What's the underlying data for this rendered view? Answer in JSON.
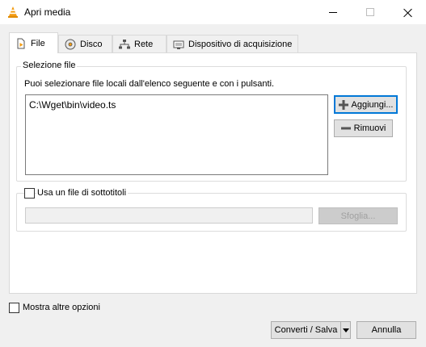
{
  "window": {
    "title": "Apri media",
    "minimize_icon": "minimize-icon",
    "maximize_icon": "maximize-icon",
    "close_icon": "close-icon"
  },
  "tabs": [
    {
      "label": "File",
      "icon": "file-icon",
      "active": true
    },
    {
      "label": "Disco",
      "icon": "disc-icon",
      "active": false
    },
    {
      "label": "Rete",
      "icon": "network-icon",
      "active": false
    },
    {
      "label": "Dispositivo di acquisizione",
      "icon": "capture-device-icon",
      "active": false
    }
  ],
  "file_selection": {
    "group_title": "Selezione file",
    "description": "Puoi selezionare file locali dall'elenco seguente e con i pulsanti.",
    "files": [
      "C:\\Wget\\bin\\video.ts"
    ],
    "add_button": "Aggiungi...",
    "remove_button": "Rimuovi"
  },
  "subtitles": {
    "checkbox_label": "Usa un file di sottotitoli",
    "checked": false,
    "path_value": "",
    "browse_button": "Sfoglia..."
  },
  "footer": {
    "more_options_label": "Mostra altre opzioni",
    "more_options_checked": false,
    "convert_button": "Converti / Salva",
    "cancel_button": "Annulla"
  },
  "colors": {
    "accent": "#0078d7",
    "vlc_orange": "#f39c12"
  }
}
